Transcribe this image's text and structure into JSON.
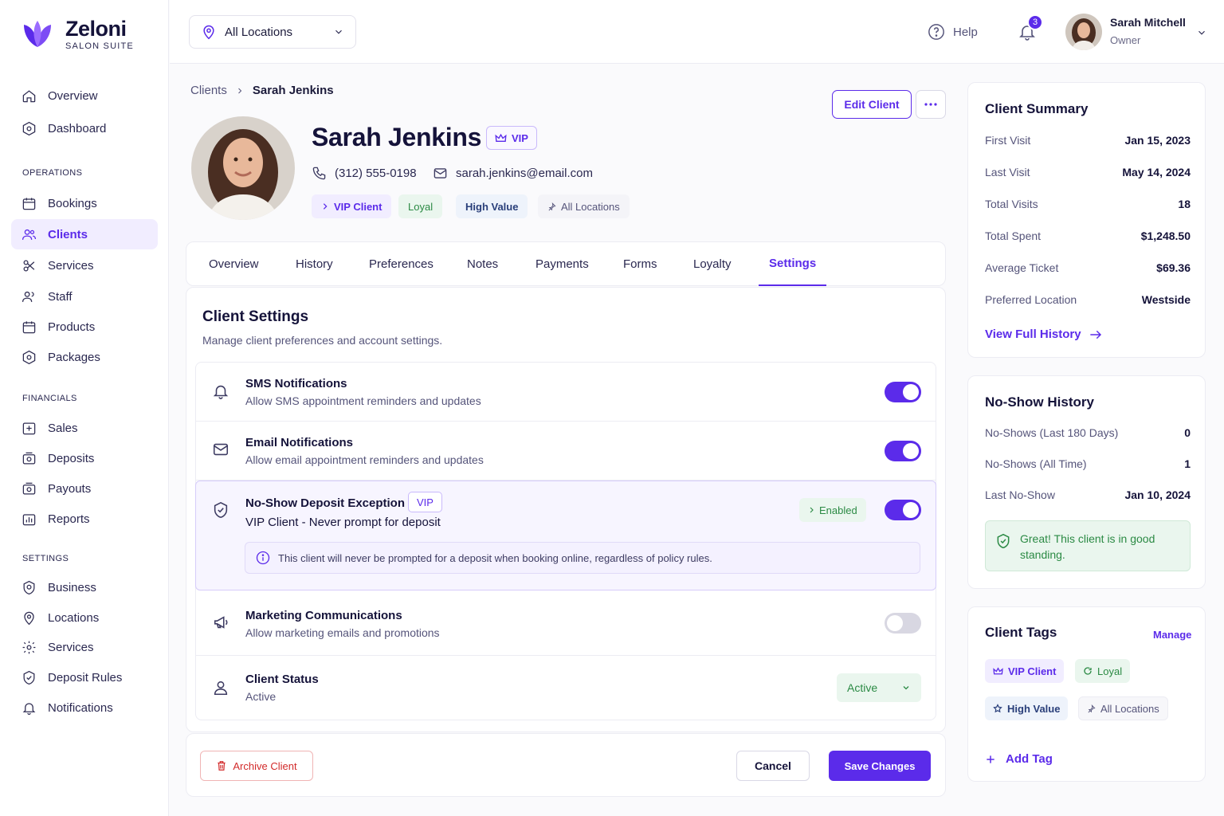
{
  "brand": {
    "name": "Zeloni",
    "subtitle": "SALON SUITE",
    "accent": "#5b2bea"
  },
  "nav": {
    "top": [
      {
        "label": "Overview",
        "icon": "home-icon"
      },
      {
        "label": "Dashboard",
        "icon": "dashboard-icon"
      }
    ],
    "operations_label": "OPERATIONS",
    "operations": [
      {
        "label": "Bookings",
        "icon": "calendar-icon"
      },
      {
        "label": "Clients",
        "icon": "users-icon",
        "active": true
      },
      {
        "label": "Services",
        "icon": "services-icon"
      },
      {
        "label": "Staff",
        "icon": "staff-icon"
      },
      {
        "label": "Products",
        "icon": "products-icon"
      },
      {
        "label": "Packages",
        "icon": "packages-icon"
      }
    ],
    "financials_label": "FINANCIALS",
    "financials": [
      {
        "label": "Sales",
        "icon": "sales-icon"
      },
      {
        "label": "Deposits",
        "icon": "deposits-icon"
      },
      {
        "label": "Payouts",
        "icon": "payouts-icon"
      },
      {
        "label": "Reports",
        "icon": "reports-icon"
      }
    ],
    "settings_label": "SETTINGS",
    "settings": [
      {
        "label": "Business",
        "icon": "business-icon"
      },
      {
        "label": "Locations",
        "icon": "location-icon"
      },
      {
        "label": "Services",
        "icon": "gear-icon"
      },
      {
        "label": "Deposit Rules",
        "icon": "shield-icon"
      },
      {
        "label": "Notifications",
        "icon": "bell-icon"
      }
    ]
  },
  "topbar": {
    "location": "All Locations",
    "help": "Help",
    "notifications_count": "3",
    "user_name": "Sarah Mitchell",
    "user_role": "Owner"
  },
  "breadcrumb": {
    "parent": "Clients",
    "current": "Sarah Jenkins"
  },
  "actions": {
    "edit": "Edit Client",
    "more": "···"
  },
  "client": {
    "name": "Sarah Jenkins",
    "vip": "VIP",
    "phone": "(312) 555-0198",
    "email": "sarah.jenkins@email.com",
    "chips": [
      "VIP Client",
      "Loyal",
      "High Value",
      "All Locations"
    ]
  },
  "tabs": [
    "Overview",
    "History",
    "Preferences",
    "Notes",
    "Payments",
    "Forms",
    "Loyalty",
    "Settings"
  ],
  "active_tab": "Settings",
  "settings": {
    "title": "Client Settings",
    "subtitle": "Manage client preferences and account settings.",
    "sms": {
      "title": "SMS Notifications",
      "desc": "Allow SMS appointment reminders and updates",
      "on": true
    },
    "email": {
      "title": "Email Notifications",
      "desc": "Allow email appointment reminders and updates",
      "on": true
    },
    "noshow": {
      "title": "No-Show Deposit Exception",
      "vip": "VIP",
      "desc": "VIP Client - Never prompt for deposit",
      "status": "Enabled",
      "on": true,
      "info": "This client will never be prompted for a deposit when booking online, regardless of policy rules."
    },
    "marketing": {
      "title": "Marketing Communications",
      "desc": "Allow marketing emails and promotions",
      "on": false
    },
    "status": {
      "title": "Client Status",
      "desc": "Active",
      "value": "Active"
    }
  },
  "footer": {
    "archive": "Archive Client",
    "cancel": "Cancel",
    "save": "Save Changes"
  },
  "summary": {
    "title": "Client Summary",
    "rows": [
      {
        "k": "First Visit",
        "v": "Jan 15, 2023"
      },
      {
        "k": "Last Visit",
        "v": "May 14, 2024"
      },
      {
        "k": "Total Visits",
        "v": "18"
      },
      {
        "k": "Total Spent",
        "v": "$1,248.50"
      },
      {
        "k": "Average Ticket",
        "v": "$69.36"
      },
      {
        "k": "Preferred Location",
        "v": "Westside"
      }
    ],
    "link": "View Full History"
  },
  "noshow_history": {
    "title": "No-Show History",
    "rows": [
      {
        "k": "No-Shows (Last 180 Days)",
        "v": "0"
      },
      {
        "k": "No-Shows (All Time)",
        "v": "1"
      },
      {
        "k": "Last No-Show",
        "v": "Jan 10, 2024"
      }
    ],
    "good": "Great! This client is in good standing."
  },
  "tags": {
    "title": "Client Tags",
    "manage": "Manage",
    "items": [
      "VIP Client",
      "Loyal",
      "High Value",
      "All Locations"
    ],
    "add": "Add Tag"
  }
}
